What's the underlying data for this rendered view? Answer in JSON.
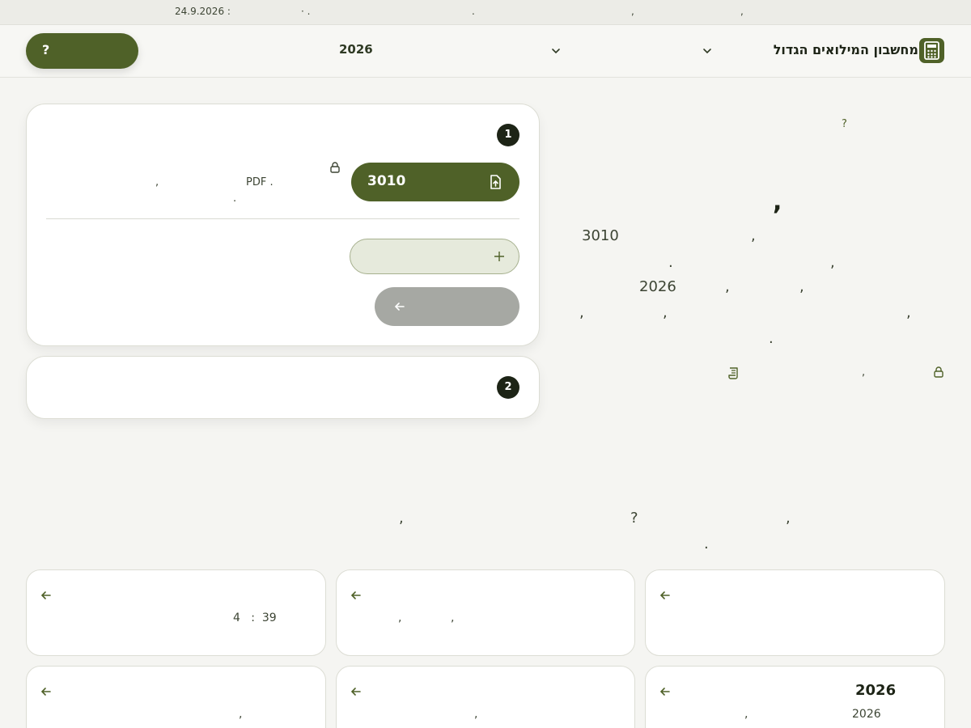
{
  "topbar": {
    "date_label": "24.9.2026 :",
    "sep_dot_bullet": "· .",
    "sep_dot_1": ".",
    "sep_comma_1": ",",
    "sep_comma_2": ","
  },
  "header": {
    "help_label": "?",
    "year_value": "2026",
    "brand_name": "מחשבון המילואים הגדול"
  },
  "step1": {
    "badge": "1",
    "upload_label": "3010",
    "note_pdf": "PDF .",
    "note_comma": ",",
    "note_dot": "."
  },
  "step2": {
    "badge": "2"
  },
  "intro": {
    "question": "?",
    "heading_mark": ",",
    "line1_value": "3010",
    "line1_comma": ",",
    "line2_dot": ".",
    "line2_comma": ",",
    "line3_year": "2026",
    "line3_comma_a": ",",
    "line3_comma_b": ",",
    "line4_comma_a": ",",
    "line4_comma_b": ",",
    "line4_comma_c": ",",
    "line5_dot": ".",
    "footer_comma": ","
  },
  "faq_intro": {
    "comma_a": ",",
    "question": "?",
    "comma_b": ",",
    "dot": "."
  },
  "tiles": [
    {
      "line": "4   :  39"
    },
    {
      "comma_a": ",",
      "comma_b": ","
    },
    {},
    {
      "comma": ","
    },
    {
      "comma": ","
    },
    {
      "title": "2026",
      "year": "2026",
      "comma": ","
    }
  ],
  "colors": {
    "brand": "#4f6128",
    "dark": "#1d2416",
    "muted_button": "#a6a8a3",
    "add_button_bg": "#e6eadc"
  }
}
